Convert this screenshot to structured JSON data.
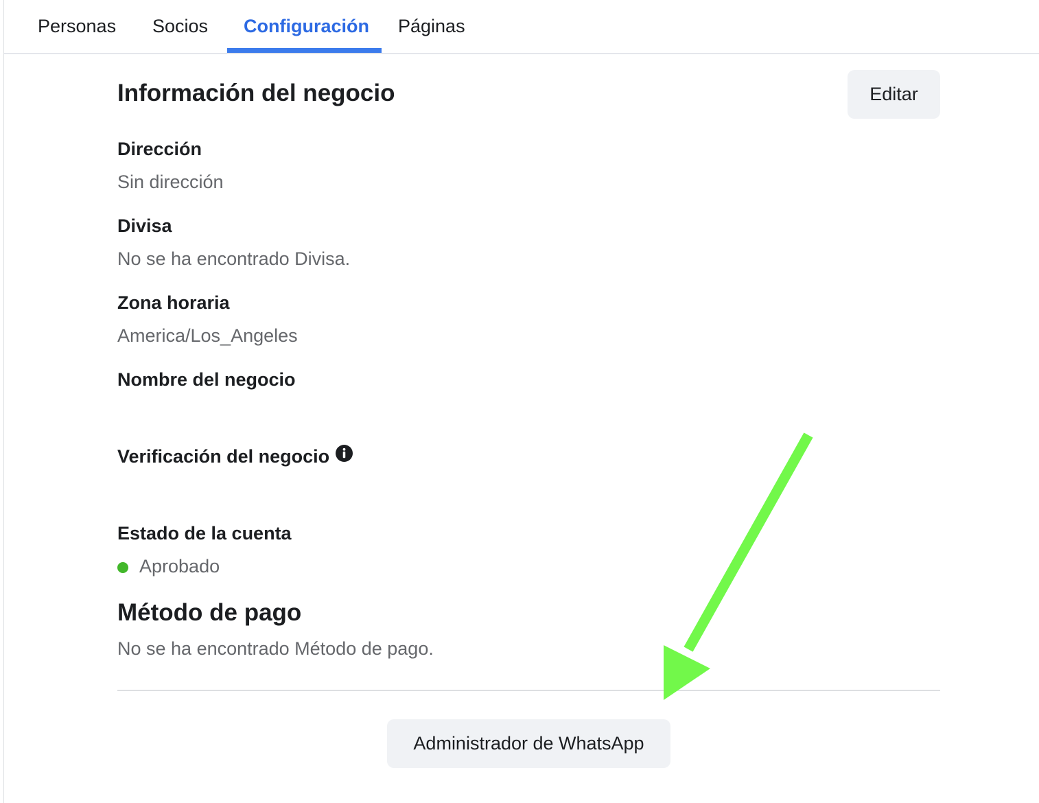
{
  "tabs": [
    {
      "label": "Personas",
      "active": false
    },
    {
      "label": "Socios",
      "active": false
    },
    {
      "label": "Configuración",
      "active": true
    },
    {
      "label": "Páginas",
      "active": false
    }
  ],
  "business_info": {
    "title": "Información del negocio",
    "edit_label": "Editar",
    "fields": {
      "address": {
        "label": "Dirección",
        "value": "Sin dirección"
      },
      "currency": {
        "label": "Divisa",
        "value": "No se ha encontrado Divisa."
      },
      "timezone": {
        "label": "Zona horaria",
        "value": "America/Los_Angeles"
      },
      "business_name": {
        "label": "Nombre del negocio",
        "value": ""
      },
      "verification": {
        "label": "Verificación del negocio",
        "icon": "info-icon"
      },
      "account_status": {
        "label": "Estado de la cuenta",
        "value": "Aprobado",
        "status_color": "#42b72a"
      }
    }
  },
  "payment": {
    "title": "Método de pago",
    "value": "No se ha encontrado Método de pago."
  },
  "whatsapp_manager_label": "Administrador de WhatsApp",
  "colors": {
    "accent": "#2d6ae3",
    "annotation_arrow": "#72f84a"
  }
}
